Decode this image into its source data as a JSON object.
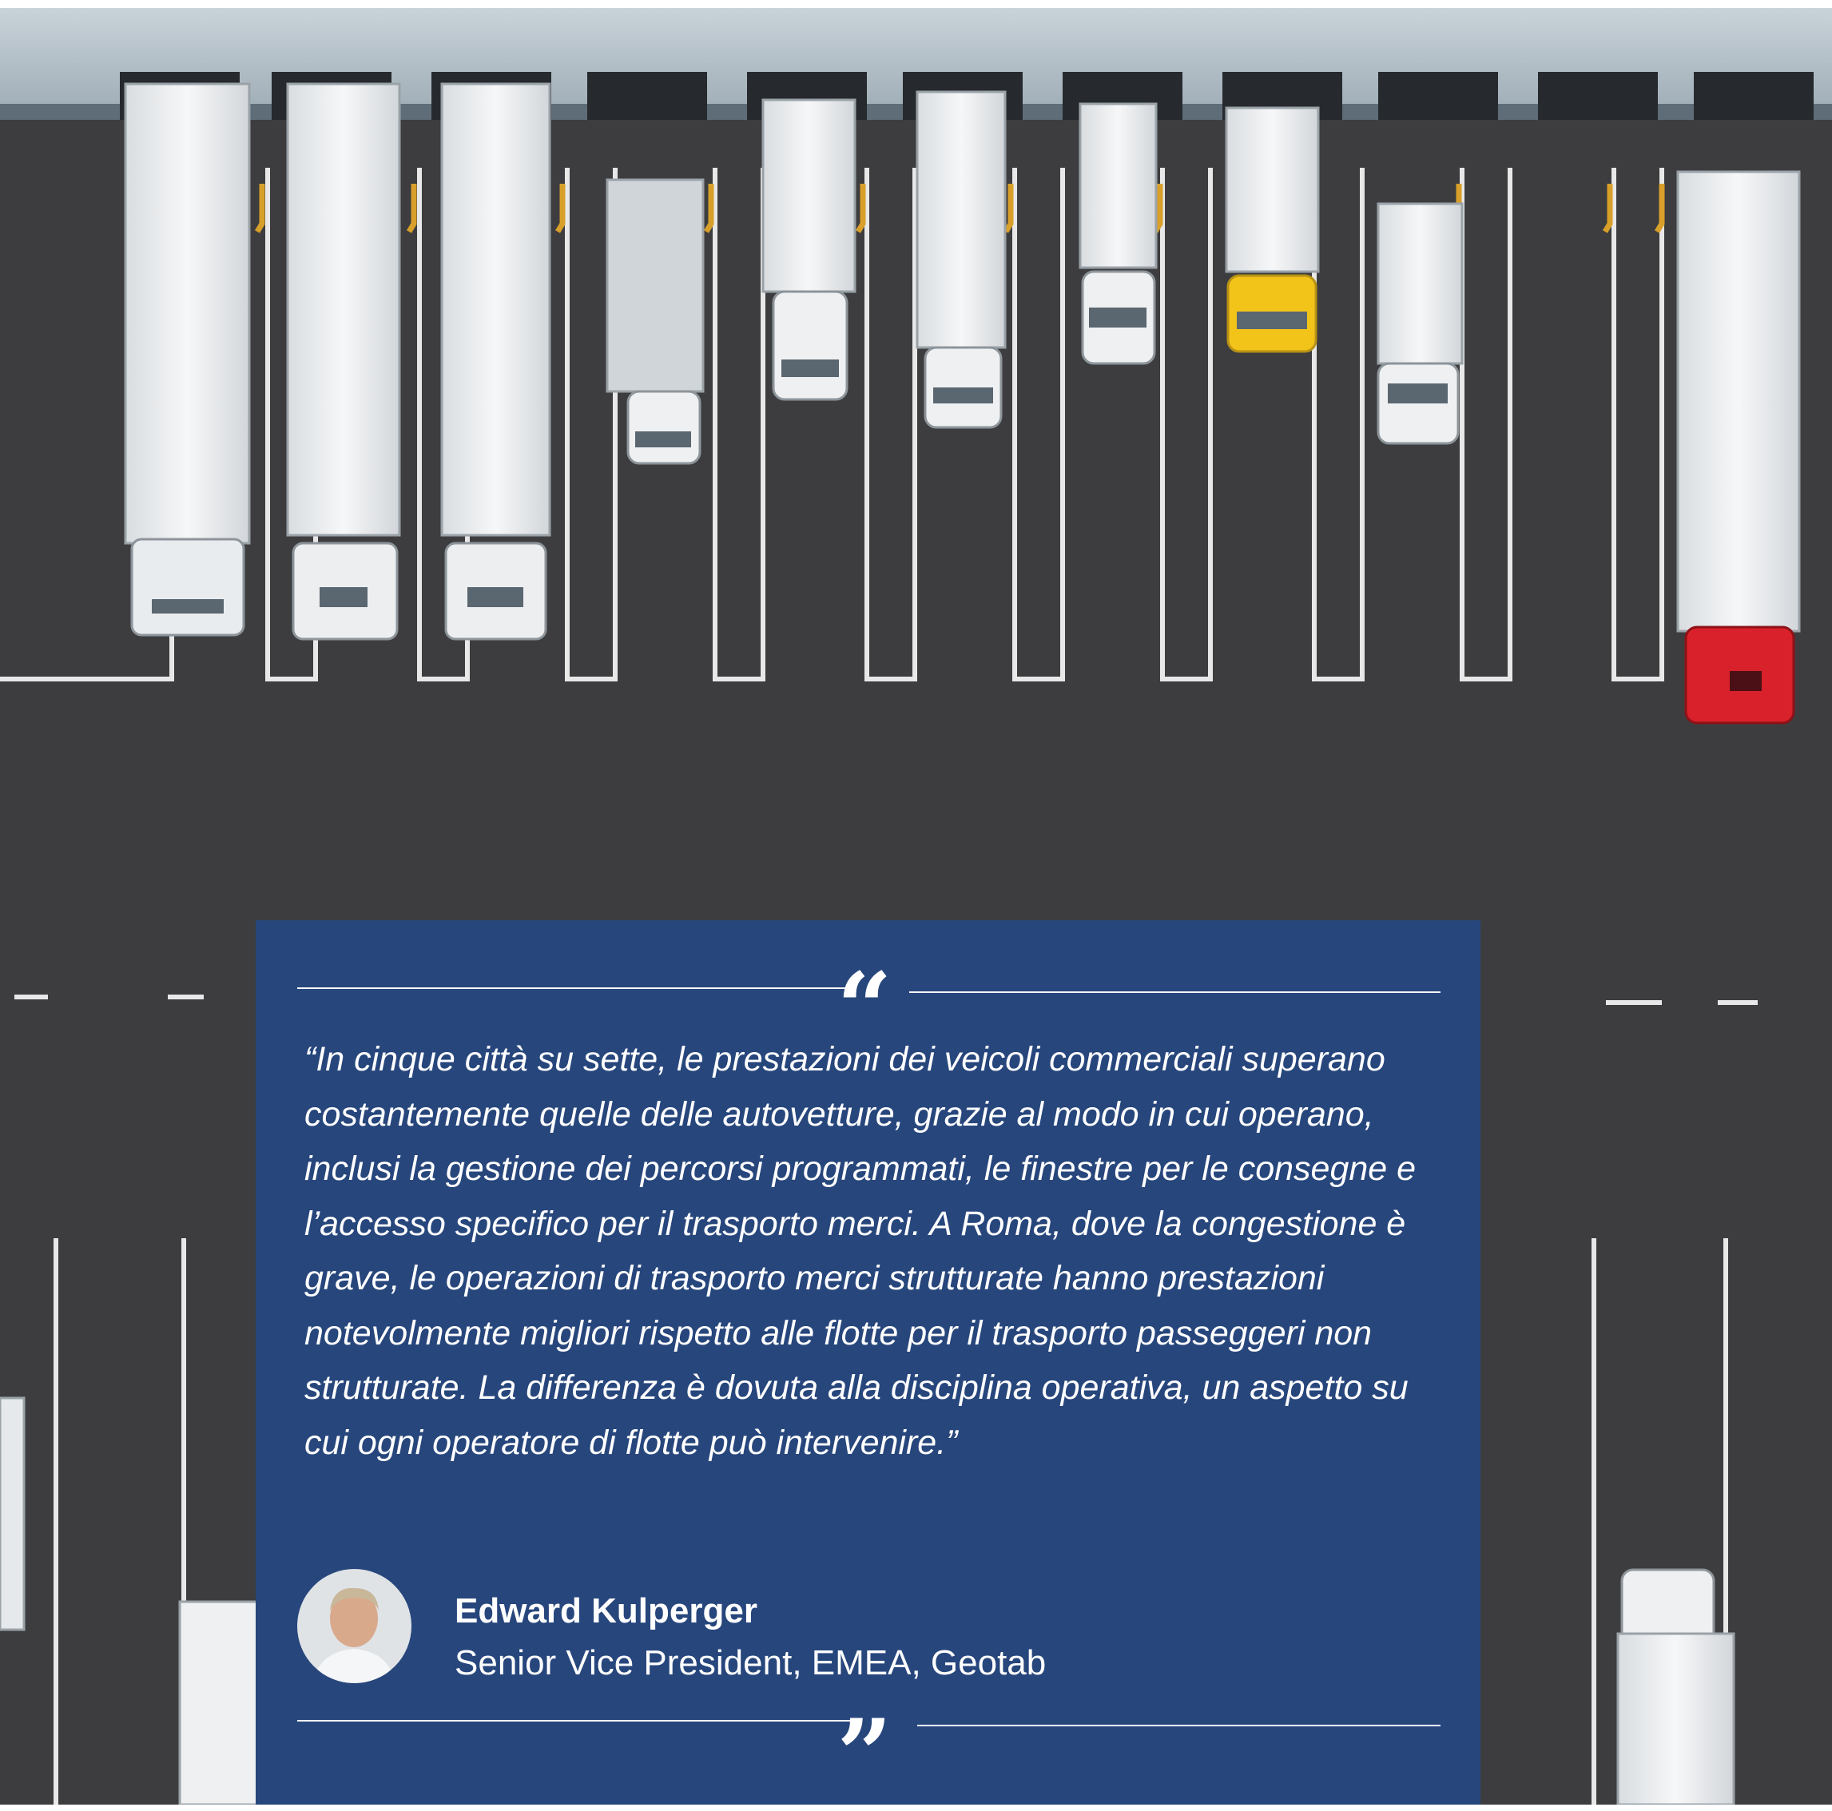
{
  "quote": {
    "open_mark": "“",
    "close_mark": "”",
    "text": "“In cinque città su sette, le prestazioni dei veicoli commerciali superano costantemente quelle delle autovetture, grazie al modo in cui operano, inclusi la gestione dei percorsi programmati, le finestre per le consegne e l’accesso specifico per il trasporto merci. A Roma, dove la congestione è grave, le operazioni di trasporto merci strutturate hanno prestazioni notevolmente migliori rispetto alle flotte per il trasporto passeggeri non strutturate. La differenza è dovuta alla disciplina operativa, un aspetto su cui ogni operatore di flotte può intervenire.”"
  },
  "author": {
    "name": "Edward Kulperger",
    "title": "Senior Vice President, EMEA, Geotab"
  },
  "colors": {
    "card": "#27467c",
    "asphalt": "#3c3c3e",
    "truck_red": "#d8212b",
    "truck_yellow": "#f2c41a"
  }
}
